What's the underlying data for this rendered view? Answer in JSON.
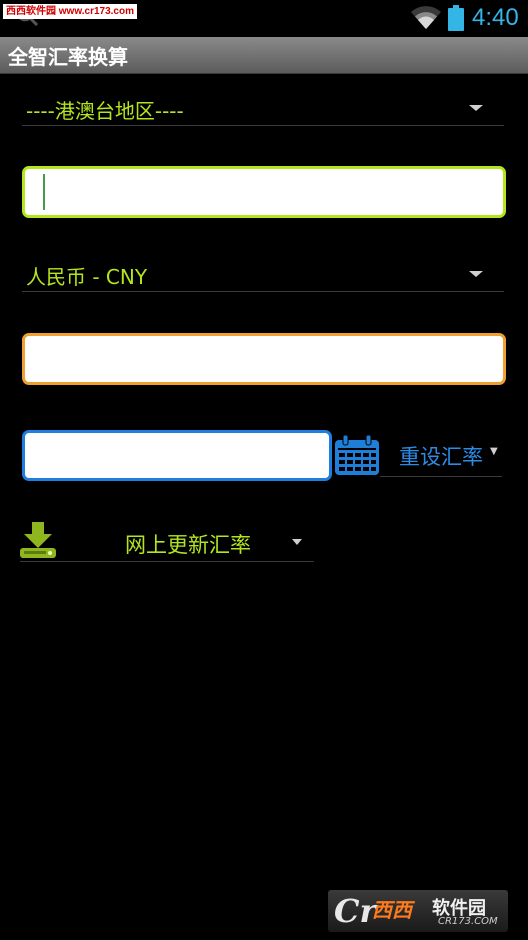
{
  "status_bar": {
    "watermark": "西西软件园 www.cr173.com",
    "time": "4:40",
    "icons": [
      "search-icon",
      "wifi-icon",
      "battery-icon"
    ]
  },
  "title_bar": {
    "title": "全智汇率换算"
  },
  "from_currency": {
    "selected": "----港澳台地区----"
  },
  "amount_from": {
    "value": "",
    "placeholder": ""
  },
  "to_currency": {
    "selected": "人民币 - CNY"
  },
  "amount_to": {
    "value": "",
    "placeholder": ""
  },
  "rate": {
    "value": "",
    "placeholder": ""
  },
  "reset_rate": {
    "label": "重设汇率"
  },
  "online_update": {
    "label": "网上更新汇率"
  },
  "watermark_bottom": {
    "logo": "Cr",
    "cn": "西西",
    "brand": "软件园",
    "url": "CR173.COM"
  },
  "colors": {
    "accent_green": "#b5e61d",
    "accent_orange": "#f0a030",
    "accent_blue": "#1e7fe0",
    "clock_blue": "#33b5e5",
    "link_blue": "#2b8be6"
  }
}
